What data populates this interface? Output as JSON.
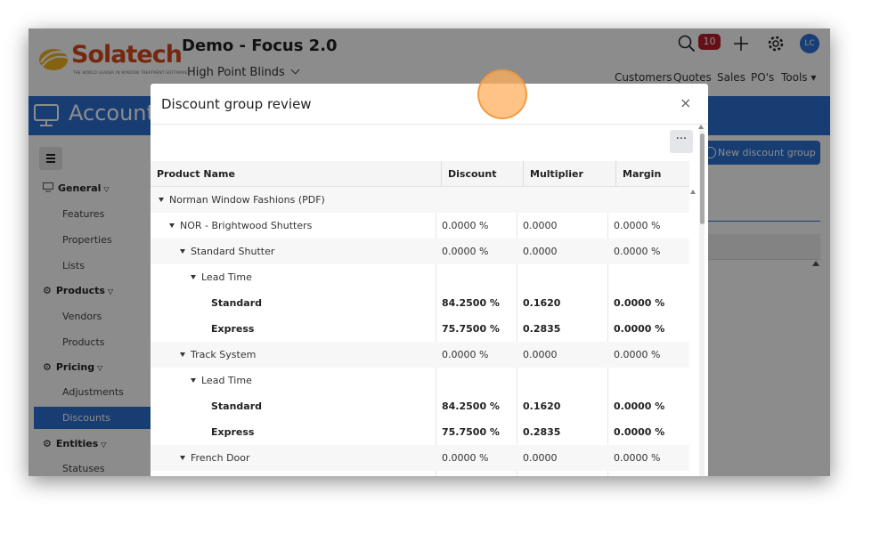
{
  "header": {
    "logo_text": "Solatech",
    "logo_tagline": "THE WORLD LEADER IN WINDOW TREATMENT SOFTWARE",
    "app_title": "Demo - Focus 2.0",
    "company": "High Point Blinds",
    "notification_count": "10",
    "avatar_initials": "LC",
    "nav": [
      "Customers",
      "Quotes",
      "Sales",
      "PO's",
      "Tools"
    ]
  },
  "band": {
    "title": "Account"
  },
  "sidebar": {
    "sections": [
      {
        "label": "General",
        "items": [
          "Features",
          "Properties",
          "Lists"
        ]
      },
      {
        "label": "Products",
        "items": [
          "Vendors",
          "Products"
        ]
      },
      {
        "label": "Pricing",
        "items": [
          "Adjustments",
          "Discounts"
        ]
      },
      {
        "label": "Entities",
        "items": [
          "Statuses"
        ]
      }
    ],
    "active_item": "Discounts"
  },
  "page": {
    "new_button_label": "New discount group"
  },
  "modal": {
    "title": "Discount group review",
    "close_glyph": "×",
    "more_glyph": "···",
    "columns": [
      "Product Name",
      "Discount",
      "Multiplier",
      "Margin"
    ],
    "rows": [
      {
        "name": "Norman Window Fashions (PDF)",
        "level": 0,
        "expander": true,
        "bold": false,
        "discount": "",
        "multiplier": "",
        "margin": ""
      },
      {
        "name": "NOR - Brightwood Shutters",
        "level": 1,
        "expander": true,
        "bold": false,
        "discount": "0.0000 %",
        "multiplier": "0.0000",
        "margin": "0.0000 %"
      },
      {
        "name": "Standard Shutter",
        "level": 2,
        "expander": true,
        "bold": false,
        "discount": "0.0000 %",
        "multiplier": "0.0000",
        "margin": "0.0000 %"
      },
      {
        "name": "Lead Time",
        "level": 3,
        "expander": true,
        "bold": false,
        "discount": "",
        "multiplier": "",
        "margin": ""
      },
      {
        "name": "Standard",
        "level": 4,
        "expander": false,
        "bold": true,
        "discount": "84.2500 %",
        "multiplier": "0.1620",
        "margin": "0.0000 %"
      },
      {
        "name": "Express",
        "level": 4,
        "expander": false,
        "bold": true,
        "discount": "75.7500 %",
        "multiplier": "0.2835",
        "margin": "0.0000 %"
      },
      {
        "name": "Track System",
        "level": 2,
        "expander": true,
        "bold": false,
        "discount": "0.0000 %",
        "multiplier": "0.0000",
        "margin": "0.0000 %"
      },
      {
        "name": "Lead Time",
        "level": 3,
        "expander": true,
        "bold": false,
        "discount": "",
        "multiplier": "",
        "margin": ""
      },
      {
        "name": "Standard",
        "level": 4,
        "expander": false,
        "bold": true,
        "discount": "84.2500 %",
        "multiplier": "0.1620",
        "margin": "0.0000 %"
      },
      {
        "name": "Express",
        "level": 4,
        "expander": false,
        "bold": true,
        "discount": "75.7500 %",
        "multiplier": "0.2835",
        "margin": "0.0000 %"
      },
      {
        "name": "French Door",
        "level": 2,
        "expander": true,
        "bold": false,
        "discount": "0.0000 %",
        "multiplier": "0.0000",
        "margin": "0.0000 %"
      }
    ]
  },
  "colors": {
    "accent": "#2d6fd2",
    "badge": "#b81c2a",
    "logo": "#d64a1e",
    "cursor": "#ffb05c"
  }
}
